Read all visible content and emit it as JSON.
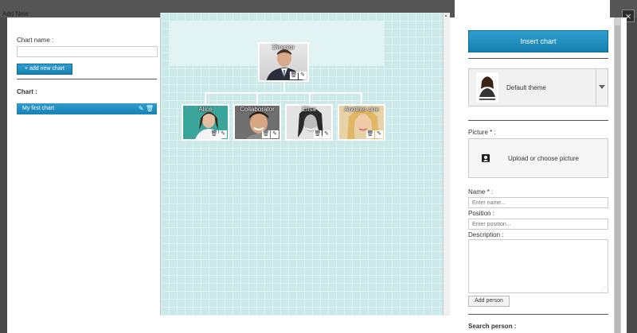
{
  "background": {
    "label": "Add New"
  },
  "dialog": {
    "close_label": "×"
  },
  "left": {
    "chart_name_label": "Chart name :",
    "chart_name_placeholder": "",
    "add_chart_label": "+ add new chart",
    "chart_heading": "Chart :",
    "charts": [
      {
        "label": "My first chart",
        "edit_icon": "✎",
        "delete_icon": "🗑"
      }
    ]
  },
  "org": {
    "director": {
      "name": "Director",
      "photo": "man-suit-photo"
    },
    "children": [
      {
        "name": "Alice",
        "photo": "woman-photo"
      },
      {
        "name": "Collaborator",
        "photo": "man-smiling-photo"
      },
      {
        "name": "Elisa",
        "photo": "woman-bw-photo"
      },
      {
        "name": "Another one",
        "photo": "blonde-woman-photo"
      }
    ],
    "delete_icon": "🗑",
    "edit_icon": "✎"
  },
  "right": {
    "insert_chart_label": "Insert chart",
    "theme_label": "Default theme",
    "picture_label": "Picture * :",
    "upload_label": "Upload or choose picture",
    "name_label": "Name * :",
    "name_placeholder": "Enter name...",
    "position_label": "Position :",
    "position_placeholder": "Enter position...",
    "description_label": "Description :",
    "add_person_label": "Add person",
    "search_label": "Search person :"
  },
  "colors": {
    "accent": "#1a8cbf",
    "canvas": "#cbe9e8"
  }
}
